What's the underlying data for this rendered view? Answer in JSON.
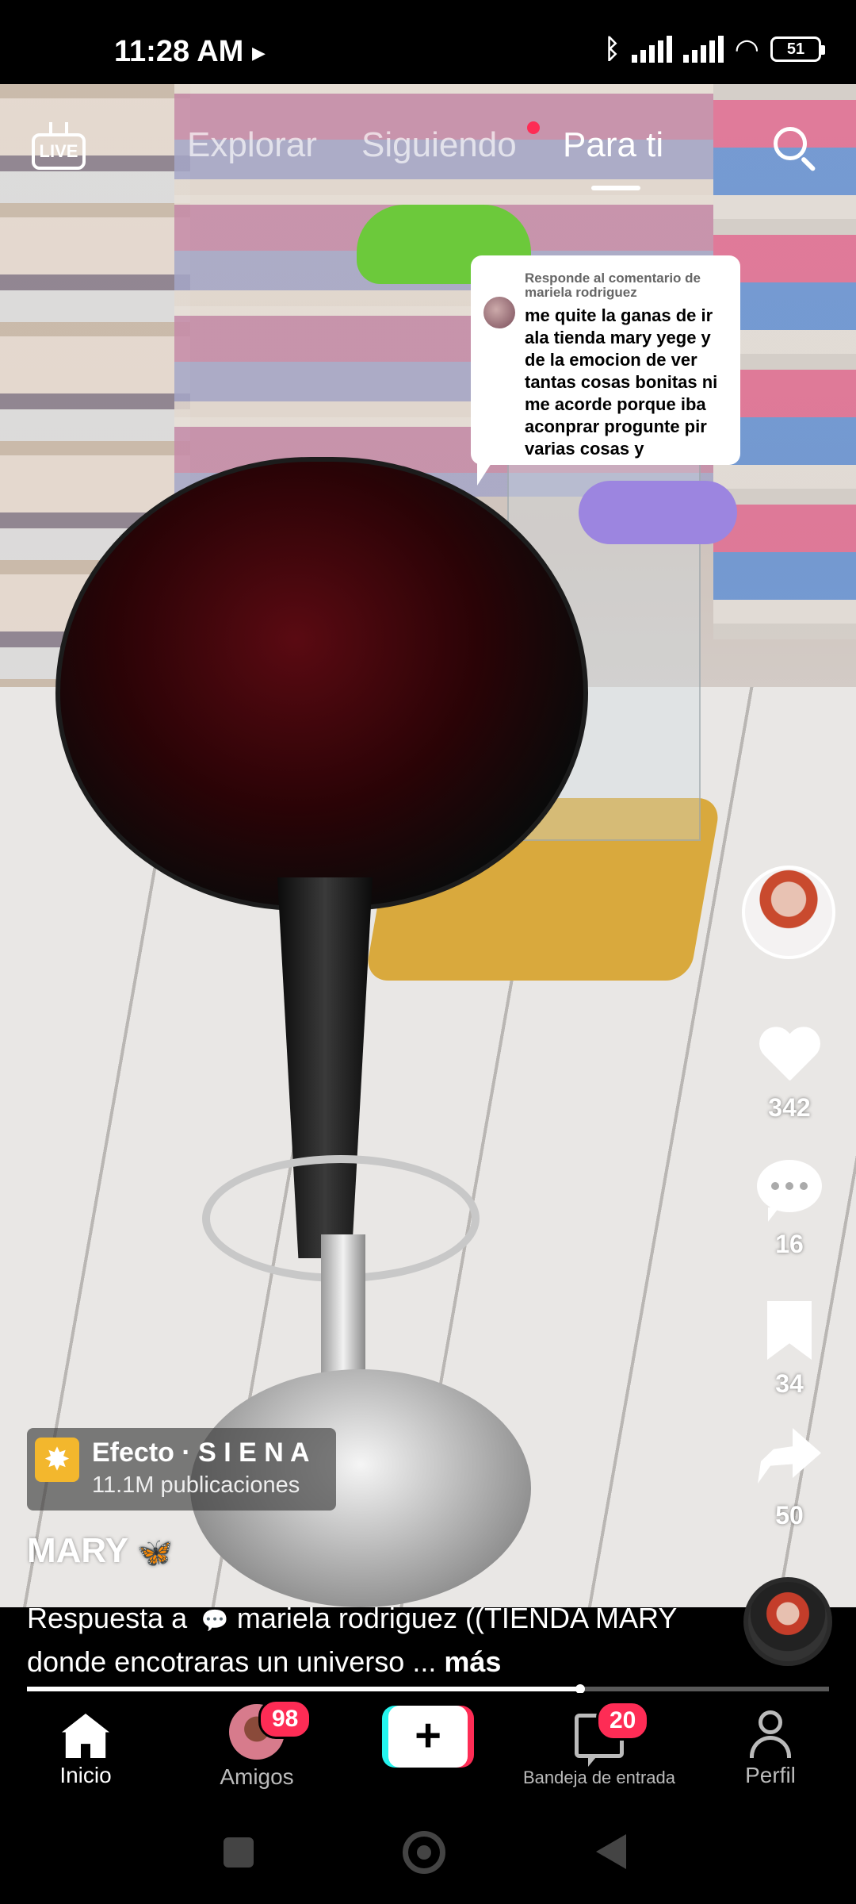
{
  "status_bar": {
    "time": "11:28 AM",
    "battery": "51",
    "icons": [
      "play-icon",
      "bluetooth-icon",
      "signal-icon",
      "signal-icon",
      "wifi-icon",
      "battery-icon"
    ]
  },
  "top_nav": {
    "live_label": "LIVE",
    "tabs": [
      {
        "label": "Explorar",
        "active": false
      },
      {
        "label": "Siguiendo",
        "active": false,
        "notification_dot": true
      },
      {
        "label": "Para ti",
        "active": true
      }
    ]
  },
  "reply_bubble": {
    "header": "Responde al comentario de mariela rodriguez",
    "text": "me quite la ganas de ir ala tienda mary yege y de la emocion de ver tantas cosas bonitas ni me acorde porque iba aconprar progunte pir varias cosas y"
  },
  "actions": {
    "likes": "342",
    "comments": "16",
    "saves": "34",
    "shares": "50"
  },
  "effect": {
    "name": "Efecto · S I E N A",
    "posts": "11.1M publicaciones"
  },
  "post": {
    "author": "MARY",
    "author_emoji": "🦋",
    "caption_prefix": "Respuesta a",
    "caption_mention": "mariela rodriguez",
    "caption_body": "((TIENDA MARY donde encotraras un universo ...",
    "more_label": "más",
    "progress": 0.69
  },
  "bottom_nav": {
    "items": [
      {
        "label": "Inicio",
        "active": true
      },
      {
        "label": "Amigos",
        "badge": "98"
      },
      {
        "label": ""
      },
      {
        "label": "Bandeja de entrada",
        "badge": "20"
      },
      {
        "label": "Perfil"
      }
    ]
  },
  "colors": {
    "accent_red": "#fe2c55",
    "accent_cyan": "#25f4ee",
    "effect_icon": "#f3b72d"
  }
}
